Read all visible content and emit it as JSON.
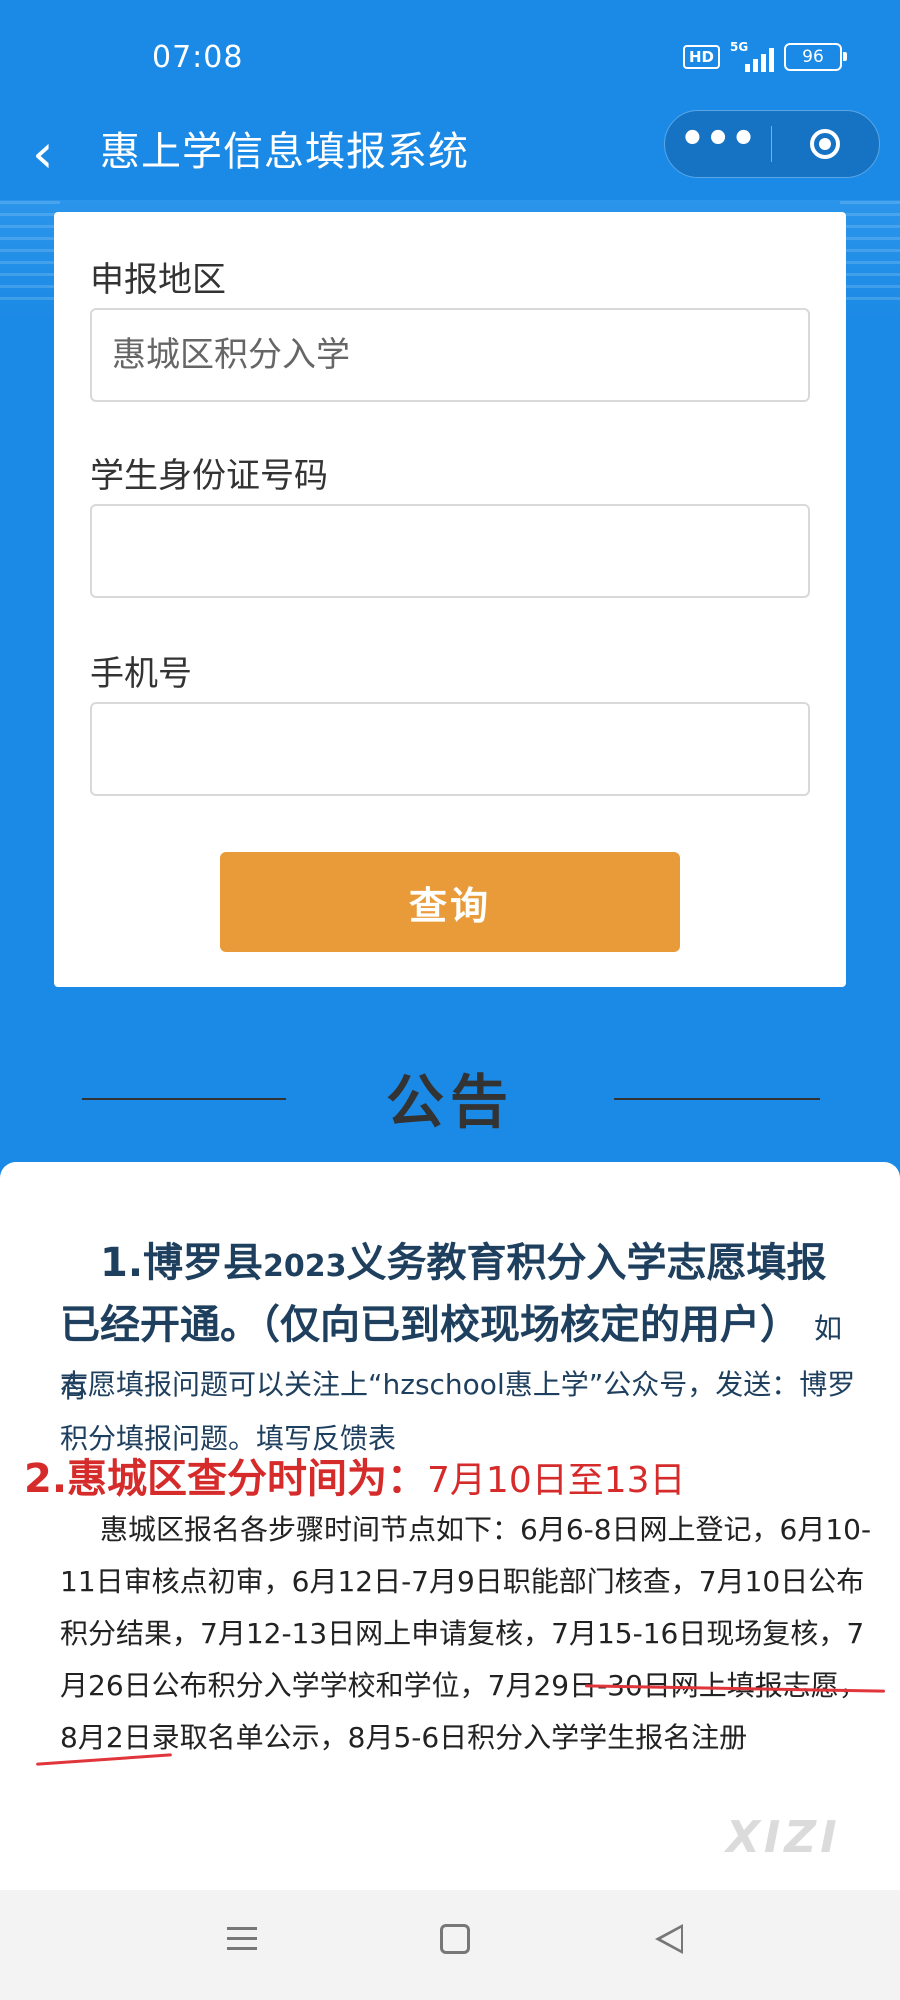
{
  "status_bar": {
    "time": "07:08",
    "hd": "HD",
    "network": "5G",
    "battery": "96"
  },
  "nav": {
    "back_icon": "‹",
    "title": "惠上学信息填报系统",
    "more_icon": "•••"
  },
  "form": {
    "region_label": "申报地区",
    "region_value": "惠城区积分入学",
    "id_label": "学生身份证号码",
    "id_value": "",
    "phone_label": "手机号",
    "phone_value": "",
    "query_button": "查询"
  },
  "notice": {
    "header": "公告",
    "item1_main": "1.博罗县",
    "item1_year": "2023",
    "item1_rest": "义务教育积分入学志愿填报已经开通。（仅向已到校现场核定的用户）",
    "item1_sub": "如有",
    "item1_note": "志愿填报问题可以关注上“hzschool惠上学”公众号，发送：博罗积分填报问题。填写反馈表",
    "item2_title": "2.惠城区查分时间为：",
    "item2_dates": "7月10日至13日",
    "item3_body": "惠城区报名各步骤时间节点如下：6月6-8日网上登记，6月10-11日审核点初审，6月12日-7月9日职能部门核查，7月10日公布积分结果，7月12-13日网上申请复核，7月15-16日现场复核，7月26日公布积分入学学校和学位，7月29日-30日网上填报志愿，8月2日录取名单公示，8月5-6日积分入学学生报名注册",
    "watermark": "XIZI"
  },
  "colors": {
    "primary_blue": "#1b8ae6",
    "button_orange": "#e89b38",
    "notice_text": "#1e3f5e",
    "alert_red": "#d62b2b"
  }
}
